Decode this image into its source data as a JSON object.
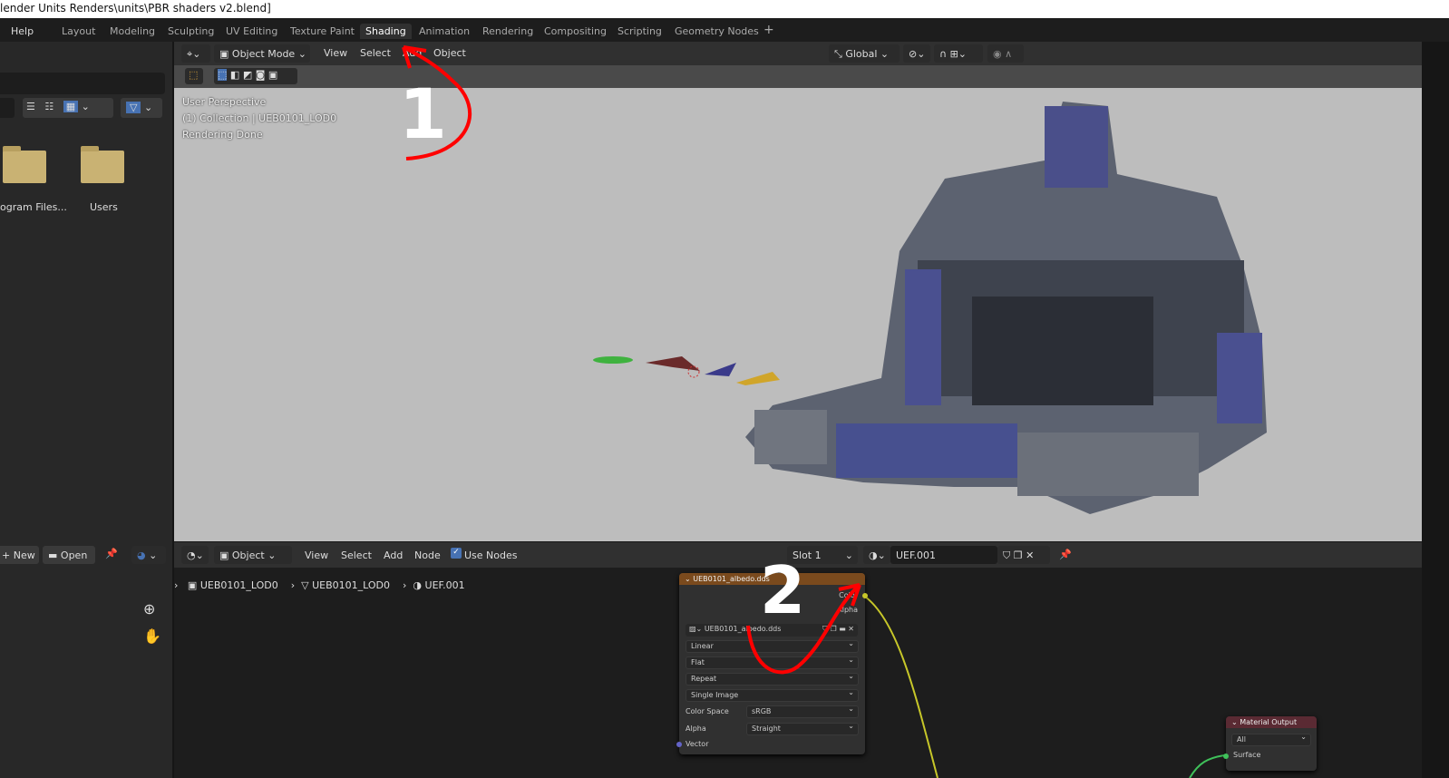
{
  "window": {
    "title": "lender Units Renders\\units\\PBR shaders v2.blend]"
  },
  "topbar": {
    "help": "Help",
    "tabs": [
      "Layout",
      "Modeling",
      "Sculpting",
      "UV Editing",
      "Texture Paint",
      "Shading",
      "Animation",
      "Rendering",
      "Compositing",
      "Scripting",
      "Geometry Nodes"
    ],
    "active_tab": "Shading",
    "add": "+"
  },
  "file_browser": {
    "folders": [
      "ogram Files...",
      "Users"
    ],
    "folder_color": "#c9b273"
  },
  "viewport": {
    "mode": "Object Mode",
    "menus": [
      "View",
      "Select",
      "Add",
      "Object"
    ],
    "orientation": "Global",
    "overlay": [
      "User Perspective",
      "(1) Collection | UEB0101_LOD0",
      "Rendering Done"
    ]
  },
  "node_editor": {
    "type": "Object",
    "menus": [
      "View",
      "Select",
      "Add",
      "Node"
    ],
    "use_nodes_label": "Use Nodes",
    "use_nodes": true,
    "slot": "Slot 1",
    "material": "UEF.001",
    "new": "New",
    "open": "Open",
    "breadcrumb": [
      "UEB0101_LOD0",
      "UEB0101_LOD0",
      "UEF.001"
    ],
    "image_node": {
      "title": "UEB0101_albedo.dds",
      "outputs": [
        "Color",
        "Alpha"
      ],
      "image": "UEB0101_albedo.dds",
      "interpolation": "Linear",
      "projection": "Flat",
      "extension": "Repeat",
      "source": "Single Image",
      "color_space_label": "Color Space",
      "color_space": "sRGB",
      "alpha_label": "Alpha",
      "alpha": "Straight",
      "input": "Vector",
      "header_color": "#7a4a1d"
    },
    "output_node": {
      "title": "Material Output",
      "target": "All",
      "input": "Surface",
      "header_color": "#5a2a33"
    }
  },
  "annotations": {
    "labels": [
      "1",
      "2"
    ],
    "color": "#ff0000"
  }
}
